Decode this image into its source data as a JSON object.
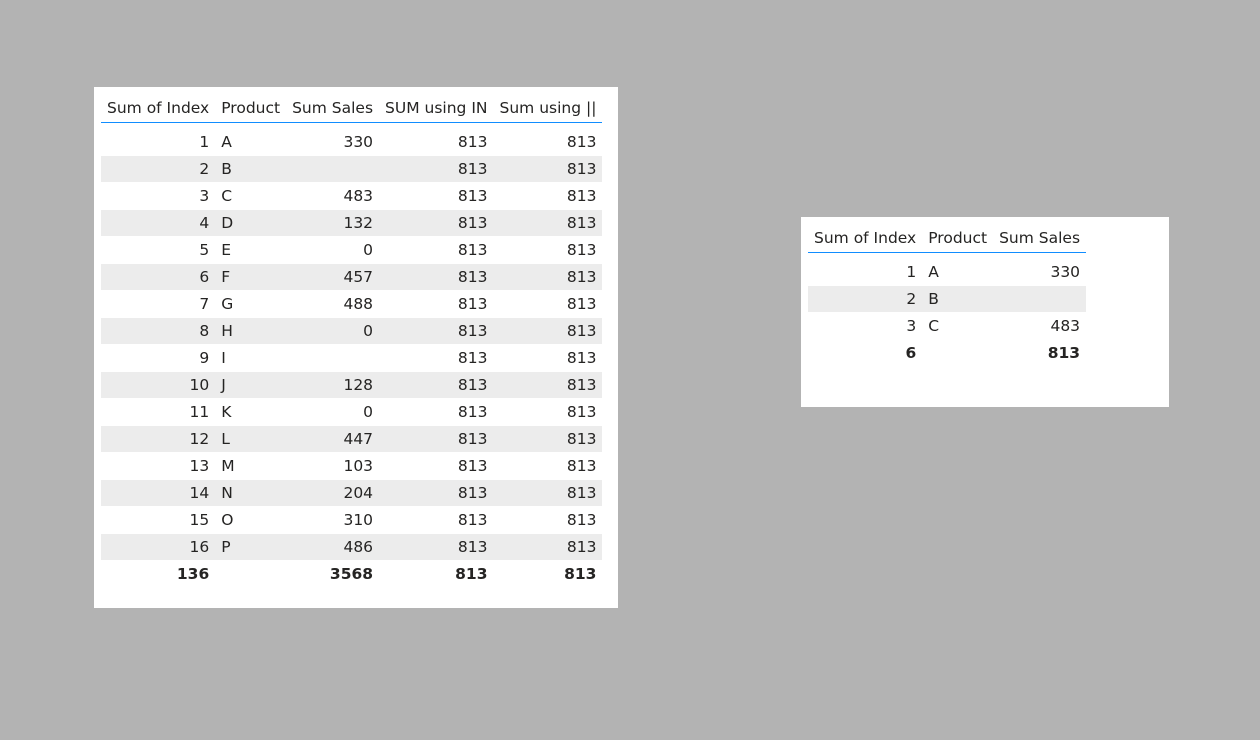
{
  "table1": {
    "headers": [
      "Sum of Index",
      "Product",
      "Sum Sales",
      "SUM using IN",
      "Sum using ||"
    ],
    "rows": [
      [
        "1",
        "A",
        "330",
        "813",
        "813"
      ],
      [
        "2",
        "B",
        "",
        "813",
        "813"
      ],
      [
        "3",
        "C",
        "483",
        "813",
        "813"
      ],
      [
        "4",
        "D",
        "132",
        "813",
        "813"
      ],
      [
        "5",
        "E",
        "0",
        "813",
        "813"
      ],
      [
        "6",
        "F",
        "457",
        "813",
        "813"
      ],
      [
        "7",
        "G",
        "488",
        "813",
        "813"
      ],
      [
        "8",
        "H",
        "0",
        "813",
        "813"
      ],
      [
        "9",
        "I",
        "",
        "813",
        "813"
      ],
      [
        "10",
        "J",
        "128",
        "813",
        "813"
      ],
      [
        "11",
        "K",
        "0",
        "813",
        "813"
      ],
      [
        "12",
        "L",
        "447",
        "813",
        "813"
      ],
      [
        "13",
        "M",
        "103",
        "813",
        "813"
      ],
      [
        "14",
        "N",
        "204",
        "813",
        "813"
      ],
      [
        "15",
        "O",
        "310",
        "813",
        "813"
      ],
      [
        "16",
        "P",
        "486",
        "813",
        "813"
      ]
    ],
    "totals": [
      "136",
      "",
      "3568",
      "813",
      "813"
    ]
  },
  "table2": {
    "headers": [
      "Sum of Index",
      "Product",
      "Sum Sales"
    ],
    "rows": [
      [
        "1",
        "A",
        "330"
      ],
      [
        "2",
        "B",
        ""
      ],
      [
        "3",
        "C",
        "483"
      ]
    ],
    "totals": [
      "6",
      "",
      "813"
    ]
  },
  "colors": {
    "canvas": "#b3b3b3",
    "visual_bg": "#ffffff",
    "accent_line": "#118dff",
    "alt_row": "#ececec"
  }
}
